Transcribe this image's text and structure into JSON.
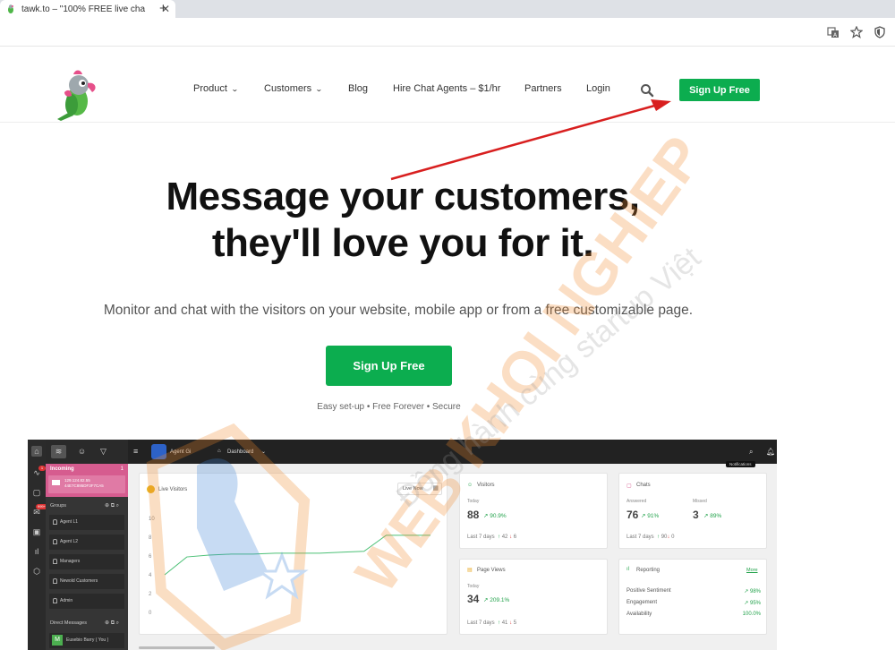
{
  "browser": {
    "tab_title": "tawk.to – \"100% FREE live cha",
    "close_glyph": "✕",
    "new_tab_glyph": "+"
  },
  "header": {
    "nav": [
      {
        "label": "Product",
        "dropdown": true
      },
      {
        "label": "Customers",
        "dropdown": true
      },
      {
        "label": "Blog",
        "dropdown": false
      },
      {
        "label": "Hire Chat Agents – $1/hr",
        "dropdown": false
      },
      {
        "label": "Partners",
        "dropdown": false
      },
      {
        "label": "Login",
        "dropdown": false
      }
    ],
    "signup_label": "Sign Up Free"
  },
  "hero": {
    "title_line1": "Message your customers,",
    "title_line2": "they'll love you for it.",
    "subtitle": "Monitor and chat with the visitors on your website, mobile app or from a free customizable page.",
    "cta_label": "Sign Up Free",
    "features": "Easy set-up • Free Forever • Secure"
  },
  "watermark": {
    "main": "WEB KHOI NGHIEP",
    "tagline": "Đồng hành cùng startup Việt"
  },
  "dashboard": {
    "topbar": {
      "agent": "Agent Gi",
      "view": "Dashboard",
      "tooltip": "Notifications"
    },
    "rail_badges": {
      "activity": "1",
      "messages": "999+"
    },
    "incoming": {
      "title": "Incoming",
      "count": "1",
      "visitor_line1": "129.124.82.55",
      "visitor_line2": "44E7C895DF3F7CA5"
    },
    "groups_label": "Groups",
    "groups": [
      "Agent L1",
      "Agent L2",
      "Managers",
      "Newold Customers",
      "Admin"
    ],
    "dm_label": "Direct Messages",
    "dm_user": "Eusebio Barry ( You )",
    "live_visitors": {
      "title": "Live Visitors",
      "filter": "Live Now",
      "y_ticks": [
        "10",
        "8",
        "6",
        "4",
        "2",
        "0"
      ]
    },
    "visitors": {
      "title": "Visitors",
      "period": "Today",
      "value": "88",
      "pct": "90.9%",
      "foot": "Last 7 days",
      "up": "42",
      "down": "6"
    },
    "chats": {
      "title": "Chats",
      "answered_label": "Answered",
      "missed_label": "Missed",
      "answered": "76",
      "answered_pct": "91%",
      "missed": "3",
      "missed_pct": "89%",
      "foot": "Last 7 days",
      "up": "90",
      "down": "0"
    },
    "pageviews": {
      "title": "Page Views",
      "period": "Today",
      "value": "34",
      "pct": "209.1%",
      "foot": "Last 7 days",
      "up": "41",
      "down": "5"
    },
    "reporting": {
      "title": "Reporting",
      "more": "More",
      "rows": [
        {
          "label": "Positive Sentiment",
          "value": "98%"
        },
        {
          "label": "Engagement",
          "value": "95%"
        },
        {
          "label": "Availability",
          "value": "100.0%"
        }
      ]
    },
    "chart_data": {
      "type": "line",
      "ylim": [
        0,
        10
      ],
      "x": [
        0,
        1,
        2,
        3,
        4,
        5,
        6,
        7,
        8,
        9,
        10,
        11,
        12
      ],
      "values": [
        4,
        5.9,
        6.1,
        6.2,
        6.2,
        6.3,
        6.3,
        6.3,
        6.4,
        6.5,
        8.2,
        8.2,
        8.2
      ]
    }
  },
  "colors": {
    "brand_green": "#0cad4f",
    "annotation_arrow": "#d81f1f",
    "incoming_pink": "#d65c8f"
  }
}
